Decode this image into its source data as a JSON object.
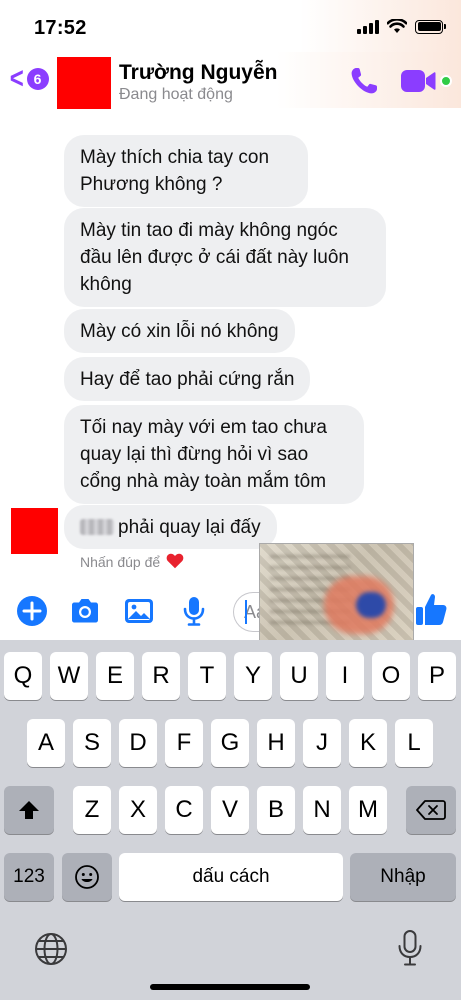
{
  "status_bar": {
    "time": "17:52"
  },
  "header": {
    "back_count": "6",
    "name": "Trường Nguyễn",
    "status": "Đang hoạt động"
  },
  "messages": [
    {
      "text": "Mày thích chia tay con Phương không ?"
    },
    {
      "text": "Mày tin tao đi mày không ngóc đầu lên được ở cái đất này luôn không"
    },
    {
      "text": "Mày có xin lỗi nó không"
    },
    {
      "text": "Hay để tao phải cứng rắn"
    },
    {
      "text": "Tối nay mày với em tao chưa quay lại thì đừng hỏi vì sao cổng nhà mày toàn mắm tôm"
    },
    {
      "text": "phải quay lại đấy"
    }
  ],
  "reaction_hint": "Nhấn đúp để",
  "composer": {
    "placeholder": "Aa"
  },
  "keyboard": {
    "row1": [
      "Q",
      "W",
      "E",
      "R",
      "T",
      "Y",
      "U",
      "I",
      "O",
      "P"
    ],
    "row2": [
      "A",
      "S",
      "D",
      "F",
      "G",
      "H",
      "J",
      "K",
      "L"
    ],
    "row3": [
      "Z",
      "X",
      "C",
      "V",
      "B",
      "N",
      "M"
    ],
    "numbers_key": "123",
    "space_key": "dấu cách",
    "return_key": "Nhập"
  },
  "colors": {
    "accent": "#8b3dff",
    "messenger_blue": "#1677ff",
    "bubble_gray": "#eeeff1",
    "online_green": "#31cc46"
  }
}
